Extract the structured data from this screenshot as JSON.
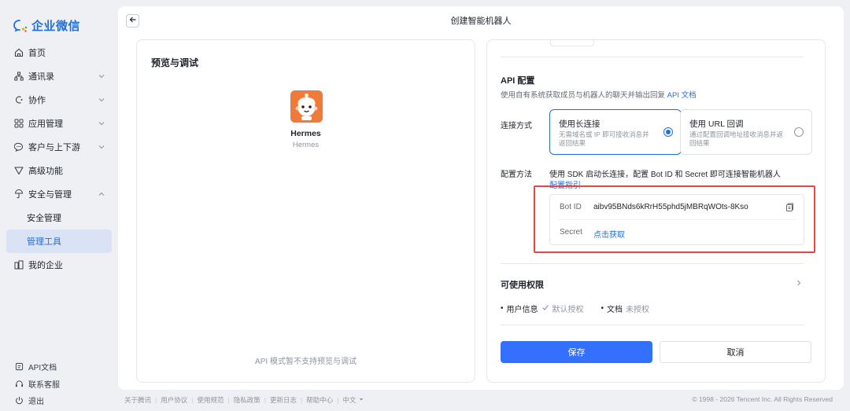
{
  "app": {
    "logo_text": "企业微信",
    "accent_color": "#1f6fe0"
  },
  "sidebar": {
    "items": [
      {
        "label": "首页",
        "icon": "home-icon"
      },
      {
        "label": "通讯录",
        "icon": "org-icon",
        "expandable": true
      },
      {
        "label": "协作",
        "icon": "collab-icon",
        "expandable": true
      },
      {
        "label": "应用管理",
        "icon": "apps-grid-icon",
        "expandable": true
      },
      {
        "label": "客户与上下游",
        "icon": "chat-bubble-icon",
        "expandable": true
      },
      {
        "label": "高级功能",
        "icon": "triangle-icon"
      },
      {
        "label": "安全与管理",
        "icon": "shield-icon",
        "expanded": true
      },
      {
        "label": "安全管理",
        "sub": true
      },
      {
        "label": "管理工具",
        "sub": true,
        "active": true
      },
      {
        "label": "我的企业",
        "icon": "building-icon"
      }
    ],
    "bottom": [
      {
        "label": "API文档",
        "icon": "doc-icon"
      },
      {
        "label": "联系客服",
        "icon": "headset-icon"
      },
      {
        "label": "退出",
        "icon": "power-icon"
      }
    ]
  },
  "header": {
    "title": "创建智能机器人"
  },
  "preview": {
    "title": "预览与调试",
    "bot_name": "Hermes",
    "bot_subtitle": "Hermes",
    "note": "API 模式暂不支持预览与调试"
  },
  "config": {
    "api_title": "API 配置",
    "api_desc": "使用自有系统获取成员与机器人的聊天并输出回复",
    "api_doc_link": "API 文档",
    "connect_label": "连接方式",
    "options": [
      {
        "title": "使用长连接",
        "desc": "无需域名或 IP 即可接收消息并返回结果",
        "selected": true
      },
      {
        "title": "使用 URL 回调",
        "desc": "通过配置回调地址接收消息并返回结果",
        "selected": false
      }
    ],
    "method_label": "配置方法",
    "method_text": "使用 SDK 启动长连接，配置 Bot ID 和 Secret 即可连接智能机器人",
    "method_link": "配置指引",
    "bot_id_label": "Bot ID",
    "bot_id_value": "aibv95BNds6kRrH55phd5jMBRqWOts-8Kso",
    "secret_label": "Secret",
    "secret_link": "点击获取",
    "permissions_title": "可使用权限",
    "permissions": [
      {
        "name": "用户信息",
        "status": "默认授权",
        "checked": true
      },
      {
        "name": "文档",
        "status": "未授权",
        "checked": false
      }
    ],
    "save_label": "保存",
    "cancel_label": "取消"
  },
  "footer": {
    "links": [
      "关于腾讯",
      "用户协议",
      "使用规范",
      "隐私政策",
      "更新日志",
      "帮助中心",
      "中文"
    ],
    "copyright": "© 1998 - 2026 Tencent Inc. All Rights Reserved"
  }
}
